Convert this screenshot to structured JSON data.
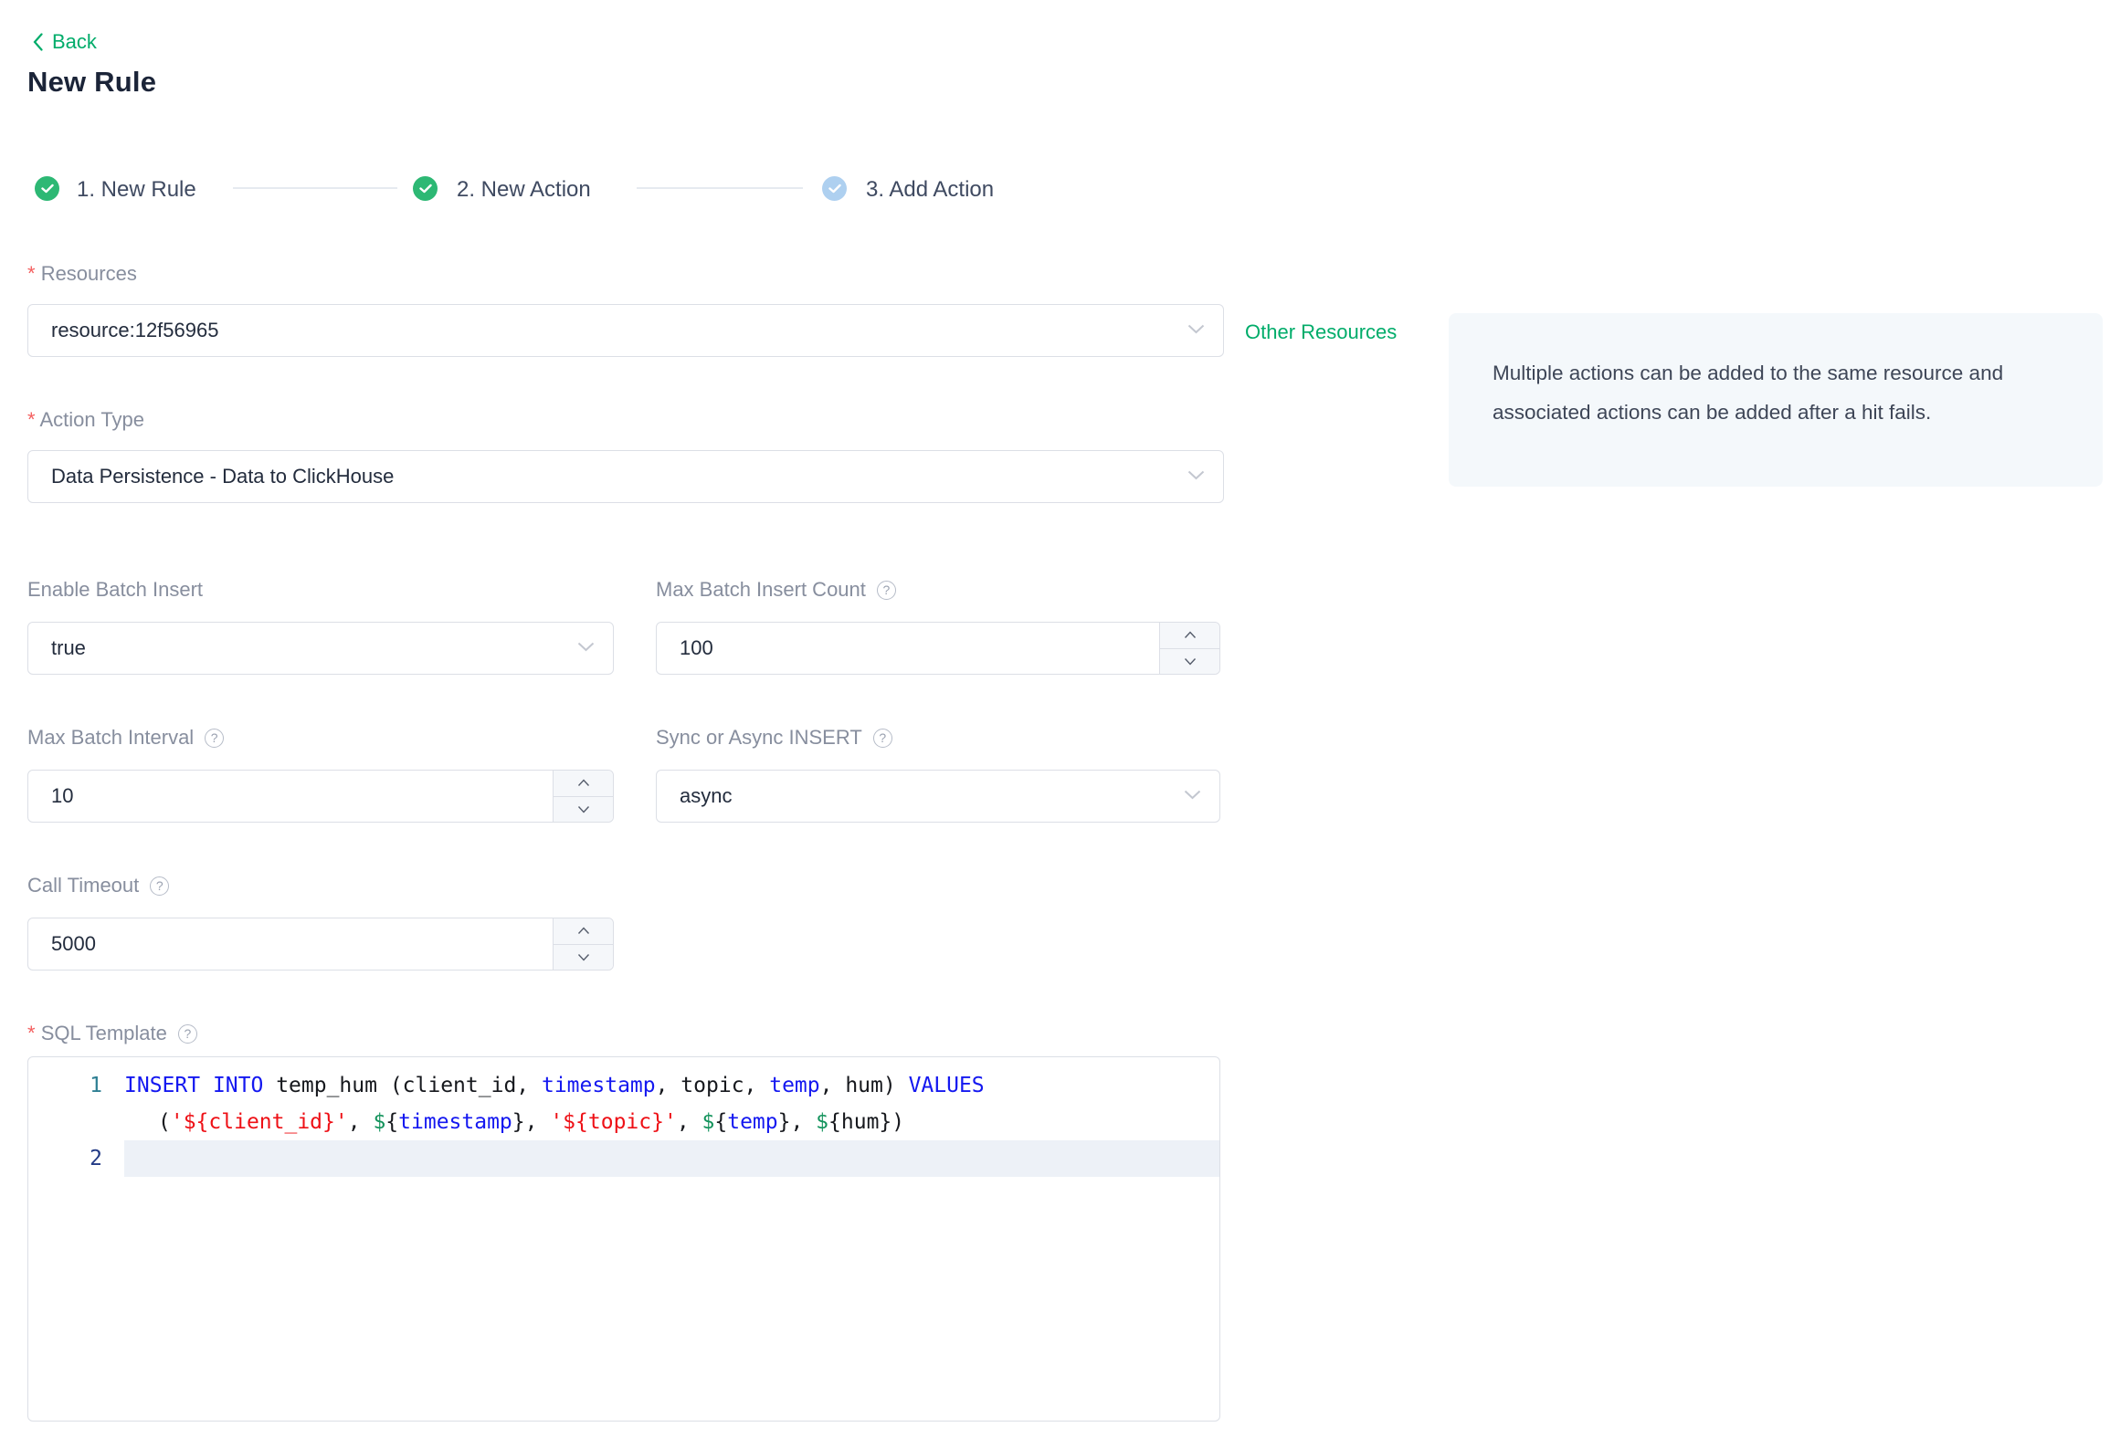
{
  "header": {
    "back": "Back",
    "title": "New Rule"
  },
  "steps": [
    {
      "label": "1. New Rule",
      "state": "done"
    },
    {
      "label": "2. New Action",
      "state": "done"
    },
    {
      "label": "3. Add Action",
      "state": "pending"
    }
  ],
  "form": {
    "resources": {
      "label": "Resources",
      "required": true,
      "value": "resource:12f56965"
    },
    "other_resources_link": "Other Resources",
    "tip_text": "Multiple actions can be added to the same resource and associated actions can be added after a hit fails.",
    "action_type": {
      "label": "Action Type",
      "required": true,
      "value": "Data Persistence - Data to ClickHouse"
    },
    "enable_batch_insert": {
      "label": "Enable Batch Insert",
      "value": "true"
    },
    "max_batch_insert_count": {
      "label": "Max Batch Insert Count",
      "value": "100"
    },
    "max_batch_interval": {
      "label": "Max Batch Interval",
      "value": "10"
    },
    "sync_or_async_insert": {
      "label": "Sync or Async INSERT",
      "value": "async"
    },
    "call_timeout": {
      "label": "Call Timeout",
      "value": "5000"
    },
    "sql_template": {
      "label": "SQL Template",
      "required": true
    }
  },
  "glyphs": {
    "help": "?"
  },
  "editor": {
    "sql": "INSERT INTO temp_hum (client_id, timestamp, topic, temp, hum) VALUES ('${client_id}', ${timestamp}, '${topic}', ${temp}, ${hum})",
    "line_numbers": [
      "1",
      "2"
    ],
    "rows": {
      "r0": [
        {
          "c": "k",
          "t": "INSERT"
        },
        {
          "c": "t",
          "t": " "
        },
        {
          "c": "k",
          "t": "INTO"
        },
        {
          "c": "t",
          "t": " temp_hum (client_id, "
        },
        {
          "c": "k",
          "t": "timestamp"
        },
        {
          "c": "t",
          "t": ", topic, "
        },
        {
          "c": "k",
          "t": "temp"
        },
        {
          "c": "t",
          "t": ", hum) "
        },
        {
          "c": "k",
          "t": "VALUES"
        }
      ],
      "r1": [
        {
          "c": "t",
          "t": "("
        },
        {
          "c": "s",
          "t": "'${client_id}'"
        },
        {
          "c": "t",
          "t": ", "
        },
        {
          "c": "v",
          "t": "$"
        },
        {
          "c": "t",
          "t": "{"
        },
        {
          "c": "k",
          "t": "timestamp"
        },
        {
          "c": "t",
          "t": "}, "
        },
        {
          "c": "s",
          "t": "'${topic}'"
        },
        {
          "c": "t",
          "t": ", "
        },
        {
          "c": "v",
          "t": "$"
        },
        {
          "c": "t",
          "t": "{"
        },
        {
          "c": "k",
          "t": "temp"
        },
        {
          "c": "t",
          "t": "}, "
        },
        {
          "c": "v",
          "t": "$"
        },
        {
          "c": "t",
          "t": "{hum})"
        }
      ]
    }
  },
  "colors": {
    "accent_green": "#00ac6a",
    "step_done_green": "#2db874",
    "step_pending_blue": "#aed0f0",
    "keyword_blue": "#1418f0",
    "string_red": "#ee1016",
    "dollar_green": "#13935c",
    "tip_background": "#f4f8fb"
  }
}
